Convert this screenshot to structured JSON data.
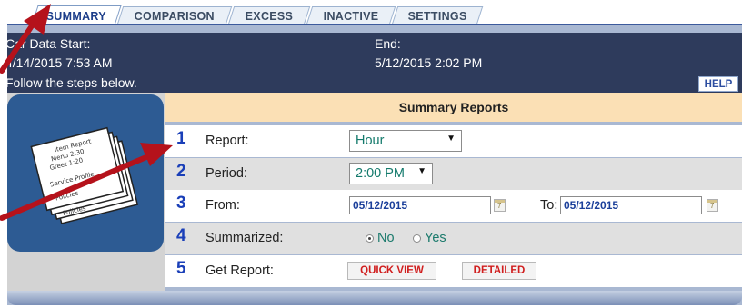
{
  "tabs": [
    {
      "label": "SUMMARY",
      "active": true
    },
    {
      "label": "COMPARISON",
      "active": false
    },
    {
      "label": "EXCESS",
      "active": false
    },
    {
      "label": "INACTIVE",
      "active": false
    },
    {
      "label": "SETTINGS",
      "active": false
    }
  ],
  "info": {
    "start_label": "Car Data Start:",
    "start_value": "4/14/2015 7:53 AM",
    "end_label": "End:",
    "end_value": "5/12/2015 2:02 PM",
    "instructions": "Follow the steps below.",
    "help_label": "HELP"
  },
  "section_title": "Summary Reports",
  "icon_paper_text": [
    "Item Report",
    "Menu 2:30",
    "Greet 1:20",
    "Service Profile",
    "Policies",
    "Policies"
  ],
  "steps": [
    {
      "number": "1",
      "label": "Report:",
      "value": "Hour"
    },
    {
      "number": "2",
      "label": "Period:",
      "value": "2:00 PM"
    },
    {
      "number": "3",
      "label": "From:",
      "from_value": "05/12/2015",
      "to_label": "To:",
      "to_value": "05/12/2015"
    },
    {
      "number": "4",
      "label": "Summarized:",
      "options": [
        "No",
        "Yes"
      ],
      "selected": "No"
    },
    {
      "number": "5",
      "label": "Get Report:",
      "quick_view_label": "QUICK VIEW",
      "detailed_label": "DETAILED"
    }
  ],
  "colors": {
    "info_bg": "#2e3b5c",
    "header_bg": "#fbe0b5",
    "step_number": "#1a3fb8",
    "button_text": "#d01e1e",
    "arrow": "#b5121b"
  },
  "icons": {
    "report_icon": "stack-of-papers-icon",
    "calendar_icon": "calendar-icon",
    "dropdown_icon": "chevron-down-icon"
  }
}
